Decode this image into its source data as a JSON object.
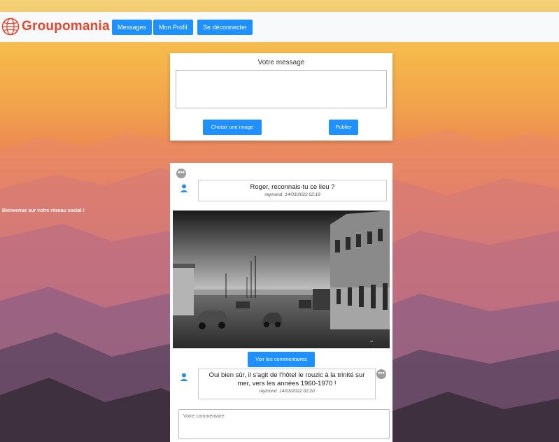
{
  "app": {
    "name": "Groupomania"
  },
  "nav": {
    "messages_label": "Messages",
    "profile_label": "Mon Profil",
    "logout_label": "Se déconnecter"
  },
  "welcome": "Bienvenue sur votre réseau social !",
  "composer": {
    "title": "Votre message",
    "choose_image_label": "Choisir une image",
    "publish_label": "Publier"
  },
  "post": {
    "text": "Roger, reconnais-tu ce lieu ?",
    "author": "raymond",
    "date": "14/03/2022 02:19",
    "view_comments_label": "Voir les commentaires"
  },
  "comment": {
    "text": "Oui bien sûr, il s'agit de l'hôtel le rouzic à la trinité sur mer, vers les années 1960-1970 !",
    "author": "raymond",
    "date": "14/03/2022 02:20"
  },
  "comment_input": {
    "placeholder": "Votre commentaire"
  },
  "colors": {
    "brand": "#e8452c",
    "accent": "#1e90ff"
  },
  "icons": {
    "logo": "globe-icon",
    "options": "more-options-icon",
    "avatar": "user-icon"
  }
}
